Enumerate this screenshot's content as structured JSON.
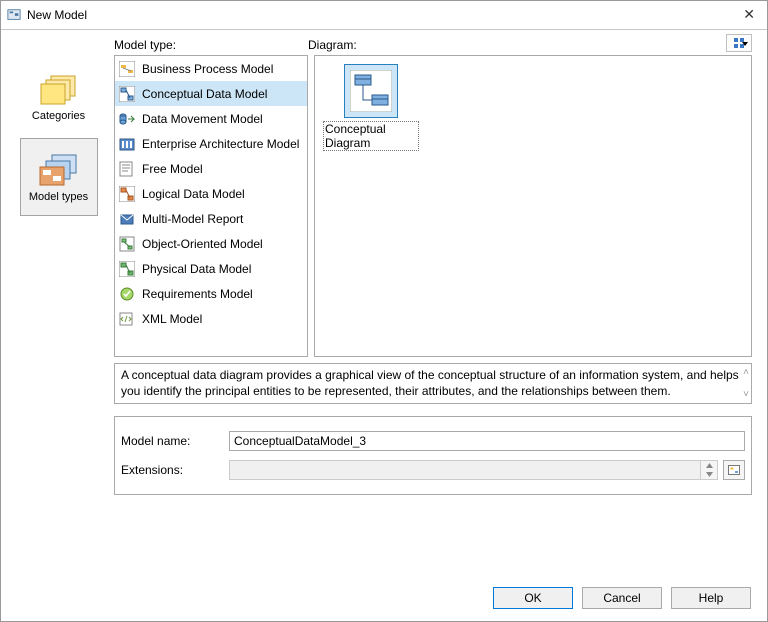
{
  "window": {
    "title": "New Model"
  },
  "left_nav": {
    "items": [
      {
        "label": "Categories"
      },
      {
        "label": "Model types"
      }
    ],
    "selected_index": 1
  },
  "labels": {
    "model_type": "Model type:",
    "diagram": "Diagram:",
    "model_name": "Model name:",
    "extensions": "Extensions:"
  },
  "model_types": {
    "selected_index": 1,
    "items": [
      {
        "label": "Business Process Model"
      },
      {
        "label": "Conceptual Data Model"
      },
      {
        "label": "Data Movement Model"
      },
      {
        "label": "Enterprise Architecture Model"
      },
      {
        "label": "Free Model"
      },
      {
        "label": "Logical Data Model"
      },
      {
        "label": "Multi-Model Report"
      },
      {
        "label": "Object-Oriented Model"
      },
      {
        "label": "Physical Data Model"
      },
      {
        "label": "Requirements Model"
      },
      {
        "label": "XML Model"
      }
    ]
  },
  "diagrams": {
    "selected_index": 0,
    "items": [
      {
        "label": "Conceptual Diagram"
      }
    ]
  },
  "description": "A conceptual data diagram provides a graphical view of the conceptual structure of an information system, and helps you identify the principal entities to be represented, their attributes, and the relationships between them.",
  "form": {
    "model_name_value": "ConceptualDataModel_3",
    "extensions_value": ""
  },
  "buttons": {
    "ok": "OK",
    "cancel": "Cancel",
    "help": "Help"
  }
}
